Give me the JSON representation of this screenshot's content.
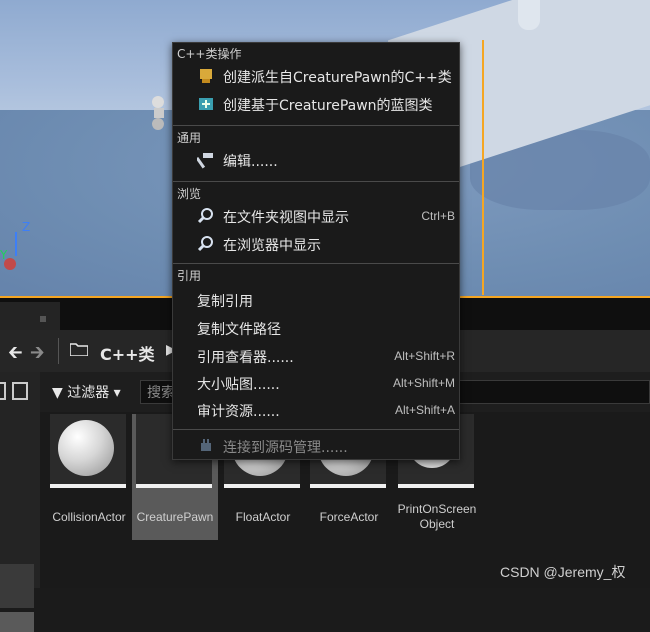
{
  "context_menu": {
    "sections": [
      {
        "title": "C++类操作",
        "items": [
          {
            "label": "创建派生自CreaturePawn的C++类",
            "icon": "cpp-class-icon"
          },
          {
            "label": "创建基于CreaturePawn的蓝图类",
            "icon": "blueprint-icon"
          }
        ]
      },
      {
        "title": "通用",
        "items": [
          {
            "label": "编辑......",
            "icon": "hammer-icon"
          }
        ]
      },
      {
        "title": "浏览",
        "items": [
          {
            "label": "在文件夹视图中显示",
            "icon": "magnifier-icon",
            "shortcut": "Ctrl+B"
          },
          {
            "label": "在浏览器中显示",
            "icon": "magnifier-icon"
          }
        ]
      },
      {
        "title": "引用",
        "items": [
          {
            "label": "复制引用"
          },
          {
            "label": "复制文件路径"
          },
          {
            "label": "引用查看器......",
            "shortcut": "Alt+Shift+R"
          },
          {
            "label": "大小贴图......",
            "shortcut": "Alt+Shift+M"
          },
          {
            "label": "审计资源......",
            "shortcut": "Alt+Shift+A"
          },
          {
            "label": "连接到源码管理......",
            "icon": "plug-icon",
            "disabled": true
          }
        ]
      }
    ]
  },
  "content_browser": {
    "path": "C++类",
    "filter_label": "过滤器",
    "search_placeholder": "搜索",
    "assets": [
      {
        "label": "CollisionActor",
        "thumb": "sphere"
      },
      {
        "label": "CreaturePawn",
        "thumb": "pawn",
        "selected": true
      },
      {
        "label": "FloatActor",
        "thumb": "sphere"
      },
      {
        "label": "ForceActor",
        "thumb": "sphere"
      },
      {
        "label": "PrintOnScreen\nObject",
        "thumb": "ring"
      }
    ]
  },
  "viewport": {
    "gizmo_z": "Z",
    "gizmo_y": "Y"
  },
  "watermark": "CSDN @Jeremy_权"
}
